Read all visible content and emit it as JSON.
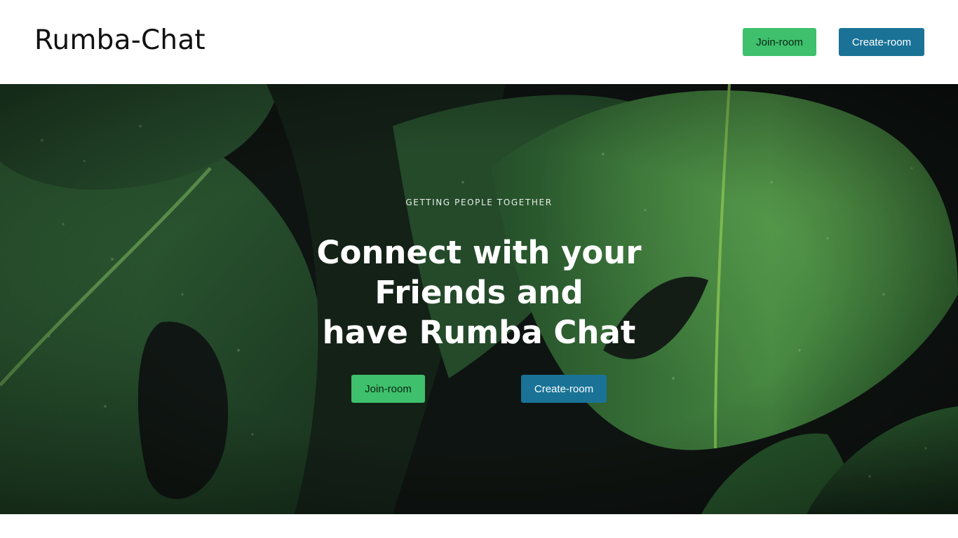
{
  "navbar": {
    "brand": "Rumba-Chat",
    "join_label": "Join-room",
    "create_label": "Create-room"
  },
  "hero": {
    "tagline": "GETTING PEOPLE TOGETHER",
    "headline_lines": [
      "Connect with your",
      "Friends and",
      "have Rumba Chat"
    ],
    "join_label": "Join-room",
    "create_label": "Create-room",
    "background_image": "monstera-leaves-with-water-drops"
  },
  "colors": {
    "join_button": "#3ec06c",
    "create_button": "#1a7397",
    "hero_dark": "#0f1512",
    "leaf_green": "#2f6b35"
  }
}
